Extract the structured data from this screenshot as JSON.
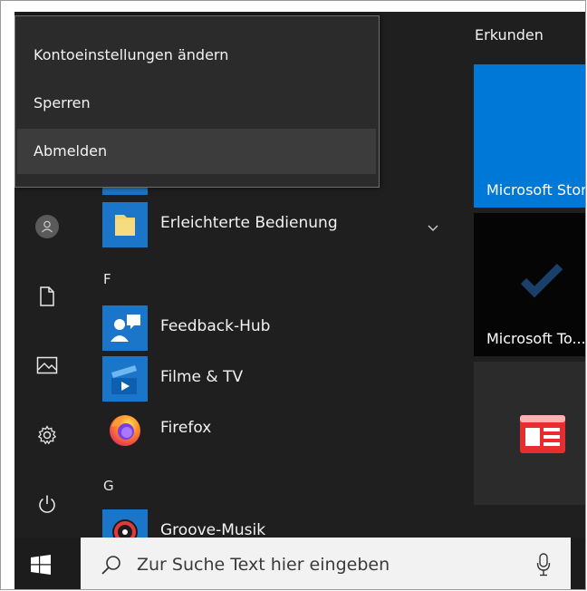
{
  "flyout": {
    "items": [
      {
        "label": "Kontoeinstellungen ändern"
      },
      {
        "label": "Sperren"
      },
      {
        "label": "Abmelden"
      }
    ]
  },
  "app_list": {
    "apps_top": [
      {
        "name": "Erleichterte Bedienung",
        "icon": "folder-icon"
      }
    ],
    "letter_f": "F",
    "apps_f": [
      {
        "name": "Feedback-Hub",
        "icon": "feedback-hub-icon"
      },
      {
        "name": "Filme & TV",
        "icon": "movies-tv-icon"
      },
      {
        "name": "Firefox",
        "icon": "firefox-icon"
      }
    ],
    "letter_g": "G",
    "apps_g": [
      {
        "name": "Groove-Musik",
        "icon": "groove-music-icon"
      }
    ]
  },
  "tiles": {
    "group_title": "Erkunden",
    "items": [
      {
        "label": "Microsoft Store",
        "color": "#0078d7"
      },
      {
        "label": "Microsoft To...",
        "color": "#000000"
      },
      {
        "label": "",
        "color": "#2b2b2b",
        "icon": "news-icon"
      }
    ]
  },
  "taskbar": {
    "search_placeholder": "Zur Suche Text hier eingeben"
  },
  "colors": {
    "accent": "#0078d7",
    "start_bg": "#1f1f1f",
    "flyout_bg": "#2b2b2b"
  }
}
